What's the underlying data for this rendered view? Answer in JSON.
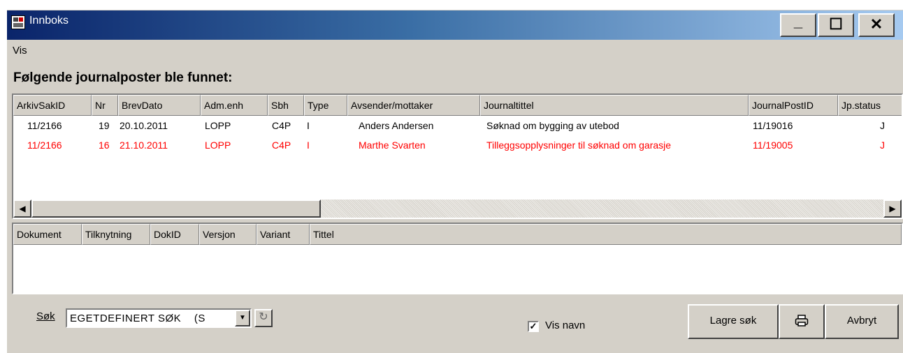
{
  "window": {
    "title": "Innboks",
    "controls": {
      "minimize": "_",
      "maximize": "☐",
      "close": "✕"
    }
  },
  "menu": {
    "items": [
      "Vis"
    ]
  },
  "heading": "Følgende journalposter ble funnet:",
  "journal_table": {
    "columns": [
      "ArkivSakID",
      "Nr",
      "BrevDato",
      "Adm.enh",
      "Sbh",
      "Type",
      "Avsender/mottaker",
      "Journaltittel",
      "JournalPostID",
      "Jp.status"
    ],
    "rows": [
      {
        "arkivsakid": "11/2166",
        "nr": "19",
        "brevdato": "20.10.2011",
        "admenh": "LOPP",
        "sbh": "C4P",
        "type": "I",
        "avsender": "Anders Andersen",
        "tittel": "Søknad om bygging av utebod",
        "journalpostid": "11/19016",
        "status": "J",
        "color": "#000000"
      },
      {
        "arkivsakid": "11/2166",
        "nr": "16",
        "brevdato": "21.10.2011",
        "admenh": "LOPP",
        "sbh": "C4P",
        "type": "I",
        "avsender": "Marthe Svarten",
        "tittel": "Tilleggsopplysninger til søknad om garasje",
        "journalpostid": "11/19005",
        "status": "J",
        "color": "#ff0000"
      }
    ]
  },
  "document_table": {
    "columns": [
      "Dokument",
      "Tilknytning",
      "DokID",
      "Versjon",
      "Variant",
      "Tittel"
    ]
  },
  "search": {
    "label": "Søk",
    "value": "EGETDEFINERT SØK",
    "value_suffix": "(S"
  },
  "vis_navn": {
    "label": "Vis navn",
    "checked": true
  },
  "buttons": {
    "lagre_sok": "Lagre søk",
    "print_icon": "printer-icon",
    "avbryt": "Avbryt"
  }
}
